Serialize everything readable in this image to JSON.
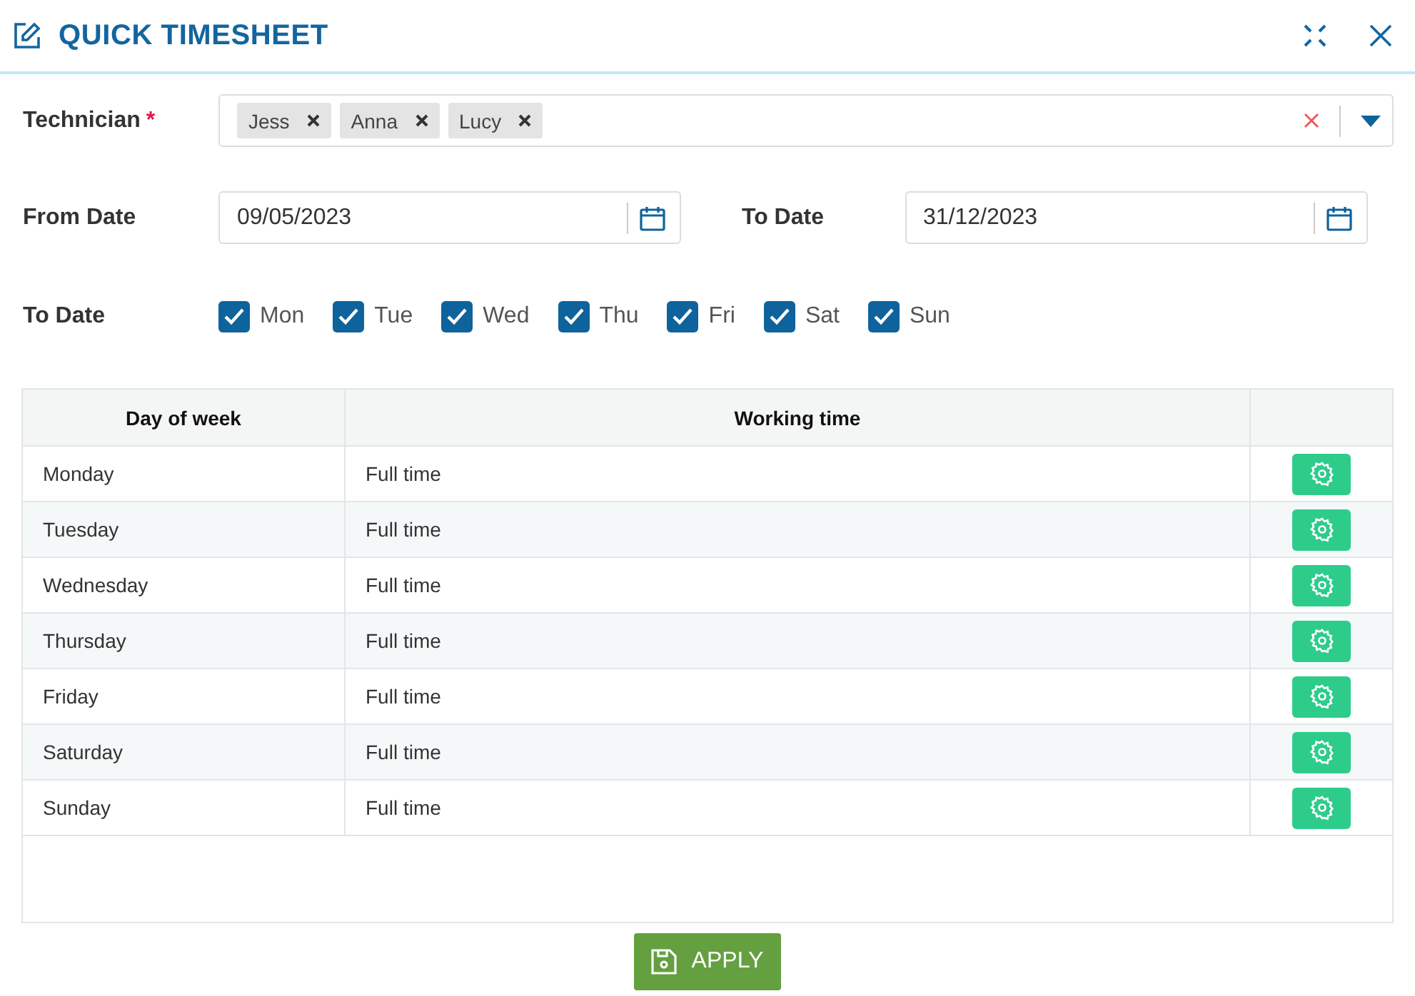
{
  "window": {
    "title": "QUICK TIMESHEET"
  },
  "technician": {
    "label": "Technician",
    "required_mark": "*",
    "tags": [
      "Jess",
      "Anna",
      "Lucy"
    ]
  },
  "from_date": {
    "label": "From Date",
    "value": "09/05/2023"
  },
  "to_date": {
    "label": "To Date",
    "value": "31/12/2023"
  },
  "days": {
    "label": "To Date",
    "items": [
      {
        "label": "Mon",
        "checked": true
      },
      {
        "label": "Tue",
        "checked": true
      },
      {
        "label": "Wed",
        "checked": true
      },
      {
        "label": "Thu",
        "checked": true
      },
      {
        "label": "Fri",
        "checked": true
      },
      {
        "label": "Sat",
        "checked": true
      },
      {
        "label": "Sun",
        "checked": true
      }
    ]
  },
  "table": {
    "columns": [
      "Day of week",
      "Working time"
    ],
    "rows": [
      {
        "day": "Monday",
        "time": "Full time"
      },
      {
        "day": "Tuesday",
        "time": "Full time"
      },
      {
        "day": "Wednesday",
        "time": "Full time"
      },
      {
        "day": "Thursday",
        "time": "Full time"
      },
      {
        "day": "Friday",
        "time": "Full time"
      },
      {
        "day": "Saturday",
        "time": "Full time"
      },
      {
        "day": "Sunday",
        "time": "Full time"
      }
    ]
  },
  "apply_button": "APPLY"
}
